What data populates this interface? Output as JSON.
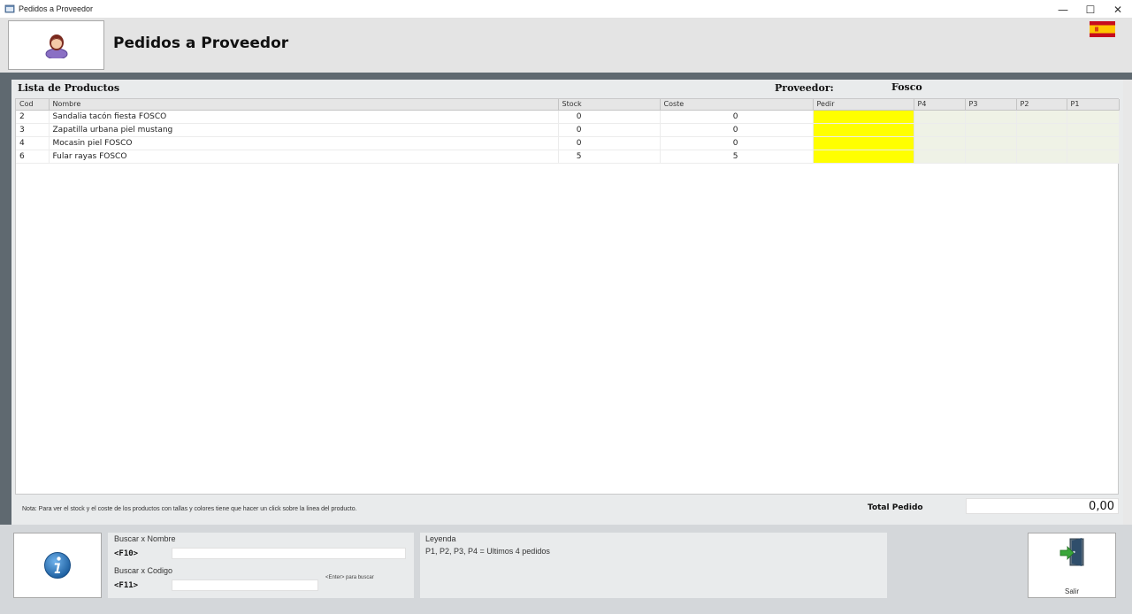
{
  "window": {
    "title": "Pedidos a Proveedor",
    "minimize_glyph": "—",
    "maximize_glyph": "☐",
    "close_glyph": "✕"
  },
  "header": {
    "title": "Pedidos a Proveedor",
    "avatar_icon": "user-avatar-icon",
    "flag_icon": "spain-flag-icon"
  },
  "list": {
    "title": "Lista de Productos",
    "provider_label": "Proveedor:",
    "provider_value": "Fosco",
    "columns": [
      "Cod",
      "Nombre",
      "Stock",
      "Coste",
      "Pedir",
      "P4",
      "P3",
      "P2",
      "P1"
    ],
    "rows": [
      {
        "cod": "2",
        "nombre": "Sandalia tacón fiesta FOSCO",
        "stock": "0",
        "coste": "0",
        "pedir": "",
        "p4": "",
        "p3": "",
        "p2": "",
        "p1": ""
      },
      {
        "cod": "3",
        "nombre": "Zapatilla urbana piel mustang",
        "stock": "0",
        "coste": "0",
        "pedir": "",
        "p4": "",
        "p3": "",
        "p2": "",
        "p1": ""
      },
      {
        "cod": "4",
        "nombre": "Mocasin piel FOSCO",
        "stock": "0",
        "coste": "0",
        "pedir": "",
        "p4": "",
        "p3": "",
        "p2": "",
        "p1": ""
      },
      {
        "cod": "6",
        "nombre": "Fular rayas FOSCO",
        "stock": "5",
        "coste": "5",
        "pedir": "",
        "p4": "",
        "p3": "",
        "p2": "",
        "p1": ""
      }
    ],
    "note": "Nota: Para ver el stock y el coste de los productos con tallas y colores tiene que hacer un click sobre la linea del producto.",
    "total_label": "Total Pedido",
    "total_value": "0,00"
  },
  "search": {
    "name_label": "Buscar  x  Nombre",
    "name_key": "<F10>",
    "name_value": "",
    "code_label": "Buscar  x  Codigo",
    "code_key": "<F11>",
    "code_value": "",
    "hint": "<Enter> para buscar"
  },
  "legend": {
    "title": "Leyenda",
    "text": "P1, P2, P3, P4 = Ultimos 4 pedidos"
  },
  "actions": {
    "info_icon": "info-icon",
    "exit_icon": "exit-door-icon",
    "exit_label": "Salir"
  },
  "colors": {
    "pedir_highlight": "#ffff00",
    "history_cells": "#eff2e6",
    "dark_band": "#5f6970",
    "info_blue": "#1d6fb5"
  }
}
